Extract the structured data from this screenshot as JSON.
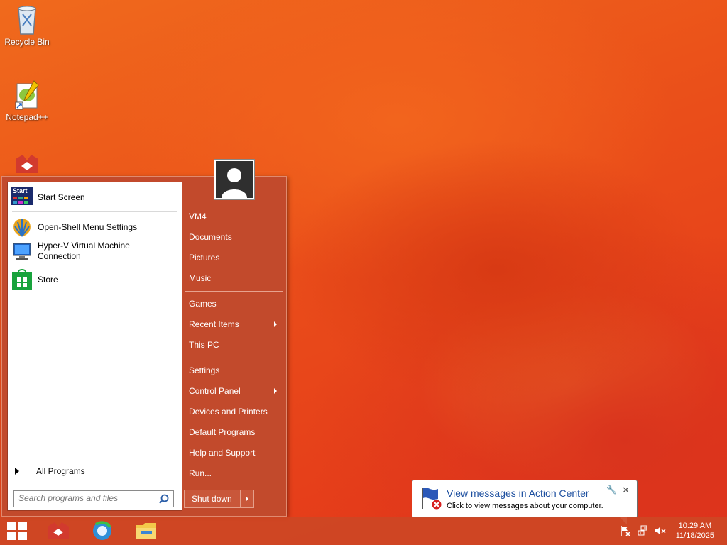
{
  "desktop": {
    "icons": [
      {
        "label": "Recycle Bin",
        "icon": "recycle-bin-icon"
      },
      {
        "label": "Notepad++",
        "icon": "notepadpp-icon"
      },
      {
        "label": "",
        "icon": "app-icon"
      }
    ]
  },
  "start_menu": {
    "pinned": [
      {
        "label": "Start Screen",
        "icon": "start-screen-icon",
        "icon_text": "Start"
      },
      {
        "label": "Open-Shell Menu Settings",
        "icon": "shell-icon"
      },
      {
        "label": "Hyper-V Virtual Machine Connection",
        "icon": "monitor-icon"
      },
      {
        "label": "Store",
        "icon": "store-icon"
      }
    ],
    "all_programs": "All Programs",
    "search_placeholder": "Search programs and files",
    "right_items": [
      {
        "label": "VM4"
      },
      {
        "label": "Documents"
      },
      {
        "label": "Pictures"
      },
      {
        "label": "Music"
      },
      {
        "label": "Games"
      },
      {
        "label": "Recent Items",
        "submenu": true
      },
      {
        "label": "This PC"
      },
      {
        "label": "Settings"
      },
      {
        "label": "Control Panel",
        "submenu": true
      },
      {
        "label": "Devices and Printers"
      },
      {
        "label": "Default Programs"
      },
      {
        "label": "Help and Support"
      },
      {
        "label": "Run..."
      }
    ],
    "shutdown_label": "Shut down"
  },
  "notification": {
    "title": "View messages in Action Center",
    "message": "Click to view messages about your computer."
  },
  "taskbar": {
    "pinned": [
      "windows-start-icon",
      "app-icon",
      "browser-icon",
      "file-explorer-icon"
    ],
    "tray": [
      "action-center-icon",
      "network-icon",
      "volume-muted-icon"
    ],
    "time": "10:29 AM",
    "date": "11/18/2025"
  },
  "colors": {
    "accent": "#c24a2c",
    "wallpaper": "#ea4e1a",
    "link_blue": "#1e50a0"
  }
}
